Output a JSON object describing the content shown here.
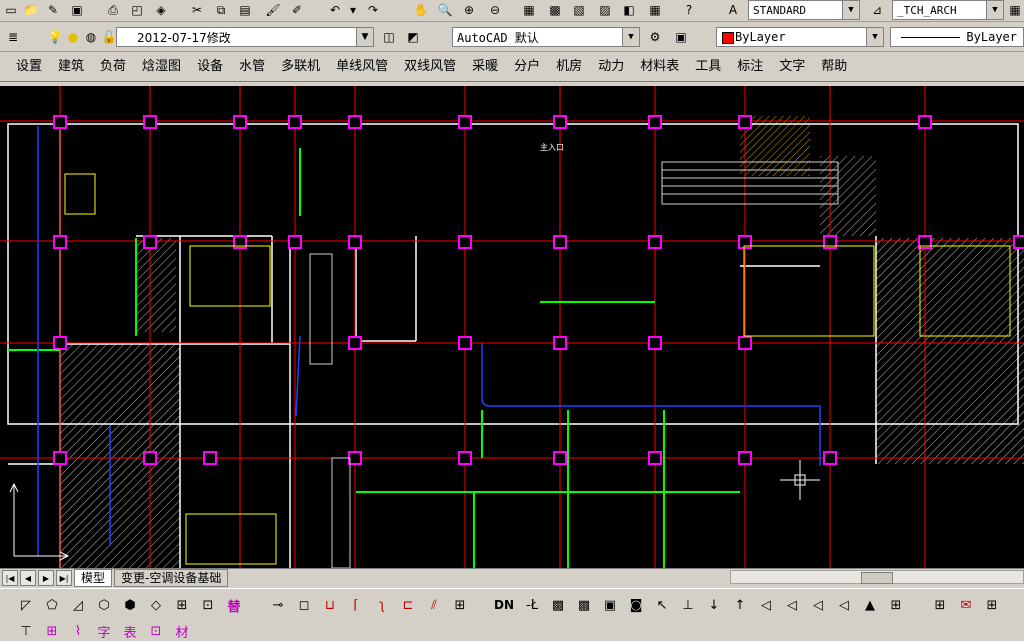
{
  "toolbar_top": {
    "text_style": "STANDARD",
    "dim_style": "_TCH_ARCH"
  },
  "toolbar_layer": {
    "layer_name": "2012-07-17修改",
    "workspace": "AutoCAD 默认",
    "color": "ByLayer",
    "linetype": "ByLayer"
  },
  "menu": [
    "设置",
    "建筑",
    "负荷",
    "焓湿图",
    "设备",
    "水管",
    "多联机",
    "单线风管",
    "双线风管",
    "采暖",
    "分户",
    "机房",
    "动力",
    "材料表",
    "工具",
    "标注",
    "文字",
    "帮助"
  ],
  "drawing": {
    "labels": [
      "主入口"
    ]
  },
  "tabs": {
    "model": "模型",
    "layout": "变更-空调设备基础"
  },
  "colors": {
    "canvas": "#000000",
    "grid": "#ff0000",
    "wall": "#ffffff",
    "column": "#ff00ff",
    "duct": "#00ff00",
    "pipe": "#0000ff",
    "hatch": "#c0c0c0",
    "equipment": "#ffff00"
  },
  "bottom_icons": [
    "DN",
    "替",
    "材",
    "字",
    "表"
  ]
}
